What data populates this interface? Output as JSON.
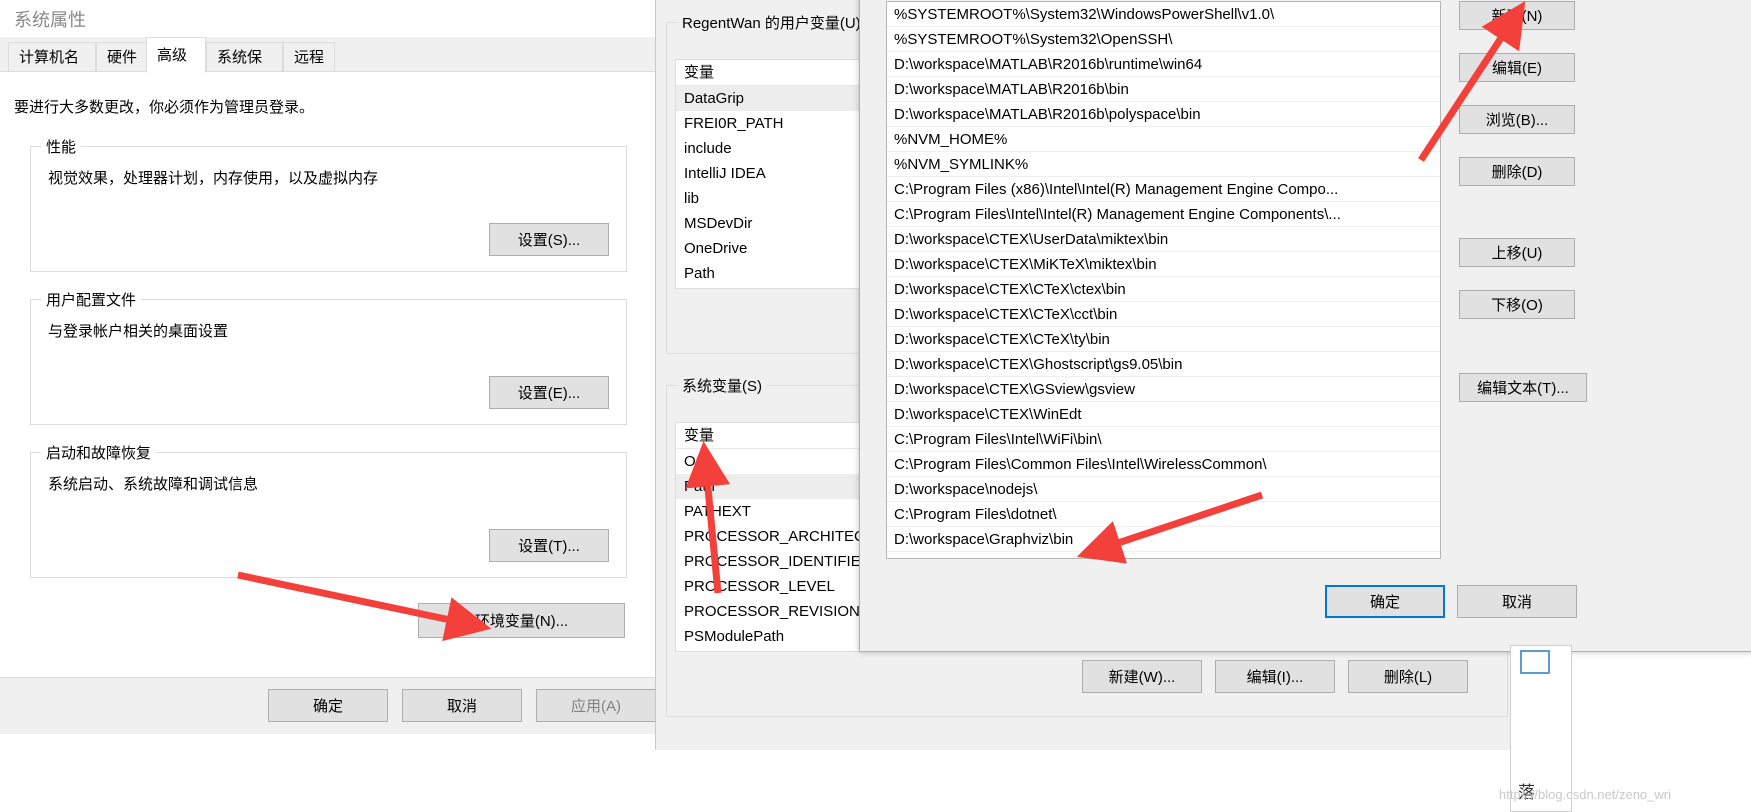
{
  "system_properties": {
    "window_title": "系统属性",
    "tabs": [
      {
        "label": "计算机名",
        "active": false
      },
      {
        "label": "硬件",
        "active": false
      },
      {
        "label": "高级",
        "active": true
      },
      {
        "label": "系统保护",
        "active": false
      },
      {
        "label": "远程",
        "active": false
      }
    ],
    "hint": "要进行大多数更改，你必须作为管理员登录。",
    "groups": [
      {
        "title": "性能",
        "desc": "视觉效果，处理器计划，内存使用，以及虚拟内存",
        "button": "设置(S)..."
      },
      {
        "title": "用户配置文件",
        "desc": "与登录帐户相关的桌面设置",
        "button": "设置(E)..."
      },
      {
        "title": "启动和故障恢复",
        "desc": "系统启动、系统故障和调试信息",
        "button": "设置(T)..."
      }
    ],
    "env_button": "环境变量(N)...",
    "footer_buttons": [
      {
        "label": "确定",
        "disabled": false
      },
      {
        "label": "取消",
        "disabled": false
      },
      {
        "label": "应用(A)",
        "disabled": true
      }
    ]
  },
  "env_vars_window": {
    "user_group_title": "RegentWan 的用户变量(U)",
    "system_group_title": "系统变量(S)",
    "column_header": "变量",
    "user_variables": [
      {
        "name": "DataGrip",
        "selected": true
      },
      {
        "name": "FREI0R_PATH",
        "selected": false
      },
      {
        "name": "include",
        "selected": false
      },
      {
        "name": "IntelliJ IDEA",
        "selected": false
      },
      {
        "name": "lib",
        "selected": false
      },
      {
        "name": "MSDevDir",
        "selected": false
      },
      {
        "name": "OneDrive",
        "selected": false
      },
      {
        "name": "Path",
        "selected": false
      }
    ],
    "system_variables": [
      {
        "name": "OS",
        "selected": false
      },
      {
        "name": "Path",
        "selected": true
      },
      {
        "name": "PATHEXT",
        "selected": false
      },
      {
        "name": "PROCESSOR_ARCHITEC",
        "selected": false
      },
      {
        "name": "PROCESSOR_IDENTIFIE",
        "selected": false
      },
      {
        "name": "PROCESSOR_LEVEL",
        "selected": false
      },
      {
        "name": "PROCESSOR_REVISION",
        "selected": false
      },
      {
        "name": "PSModulePath",
        "selected": false
      }
    ],
    "system_buttons": [
      {
        "label": "新建(W)..."
      },
      {
        "label": "编辑(I)..."
      },
      {
        "label": "删除(L)"
      }
    ]
  },
  "edit_env_dialog": {
    "paths": [
      "%SYSTEMROOT%\\System32\\WindowsPowerShell\\v1.0\\",
      "%SYSTEMROOT%\\System32\\OpenSSH\\",
      "D:\\workspace\\MATLAB\\R2016b\\runtime\\win64",
      "D:\\workspace\\MATLAB\\R2016b\\bin",
      "D:\\workspace\\MATLAB\\R2016b\\polyspace\\bin",
      "%NVM_HOME%",
      "%NVM_SYMLINK%",
      "C:\\Program Files (x86)\\Intel\\Intel(R) Management Engine Compo...",
      "C:\\Program Files\\Intel\\Intel(R) Management Engine Components\\...",
      "D:\\workspace\\CTEX\\UserData\\miktex\\bin",
      "D:\\workspace\\CTEX\\MiKTeX\\miktex\\bin",
      "D:\\workspace\\CTEX\\CTeX\\ctex\\bin",
      "D:\\workspace\\CTEX\\CTeX\\cct\\bin",
      "D:\\workspace\\CTEX\\CTeX\\ty\\bin",
      "D:\\workspace\\CTEX\\Ghostscript\\gs9.05\\bin",
      "D:\\workspace\\CTEX\\GSview\\gsview",
      "D:\\workspace\\CTEX\\WinEdt",
      "C:\\Program Files\\Intel\\WiFi\\bin\\",
      "C:\\Program Files\\Common Files\\Intel\\WirelessCommon\\",
      "D:\\workspace\\nodejs\\",
      "C:\\Program Files\\dotnet\\",
      "D:\\workspace\\Graphviz\\bin"
    ],
    "side_buttons": [
      {
        "label": "新建(N)",
        "name": "new"
      },
      {
        "label": "编辑(E)",
        "name": "edit"
      },
      {
        "label": "浏览(B)...",
        "name": "browse"
      },
      {
        "label": "删除(D)",
        "name": "delete"
      },
      {
        "label": "上移(U)",
        "name": "move-up"
      },
      {
        "label": "下移(O)",
        "name": "move-down"
      },
      {
        "label": "编辑文本(T)...",
        "name": "edit-text"
      }
    ],
    "ok_label": "确定",
    "cancel_label": "取消",
    "scrollbar": {
      "up_glyph": "︿",
      "down_glyph": "﹀"
    }
  },
  "annotations": {
    "arrow_color": "#f4403a",
    "arrow_count": 4
  },
  "watermark": {
    "text": "https://blog.csdn.net/zeno_wri"
  },
  "corner": {
    "label": "落"
  }
}
